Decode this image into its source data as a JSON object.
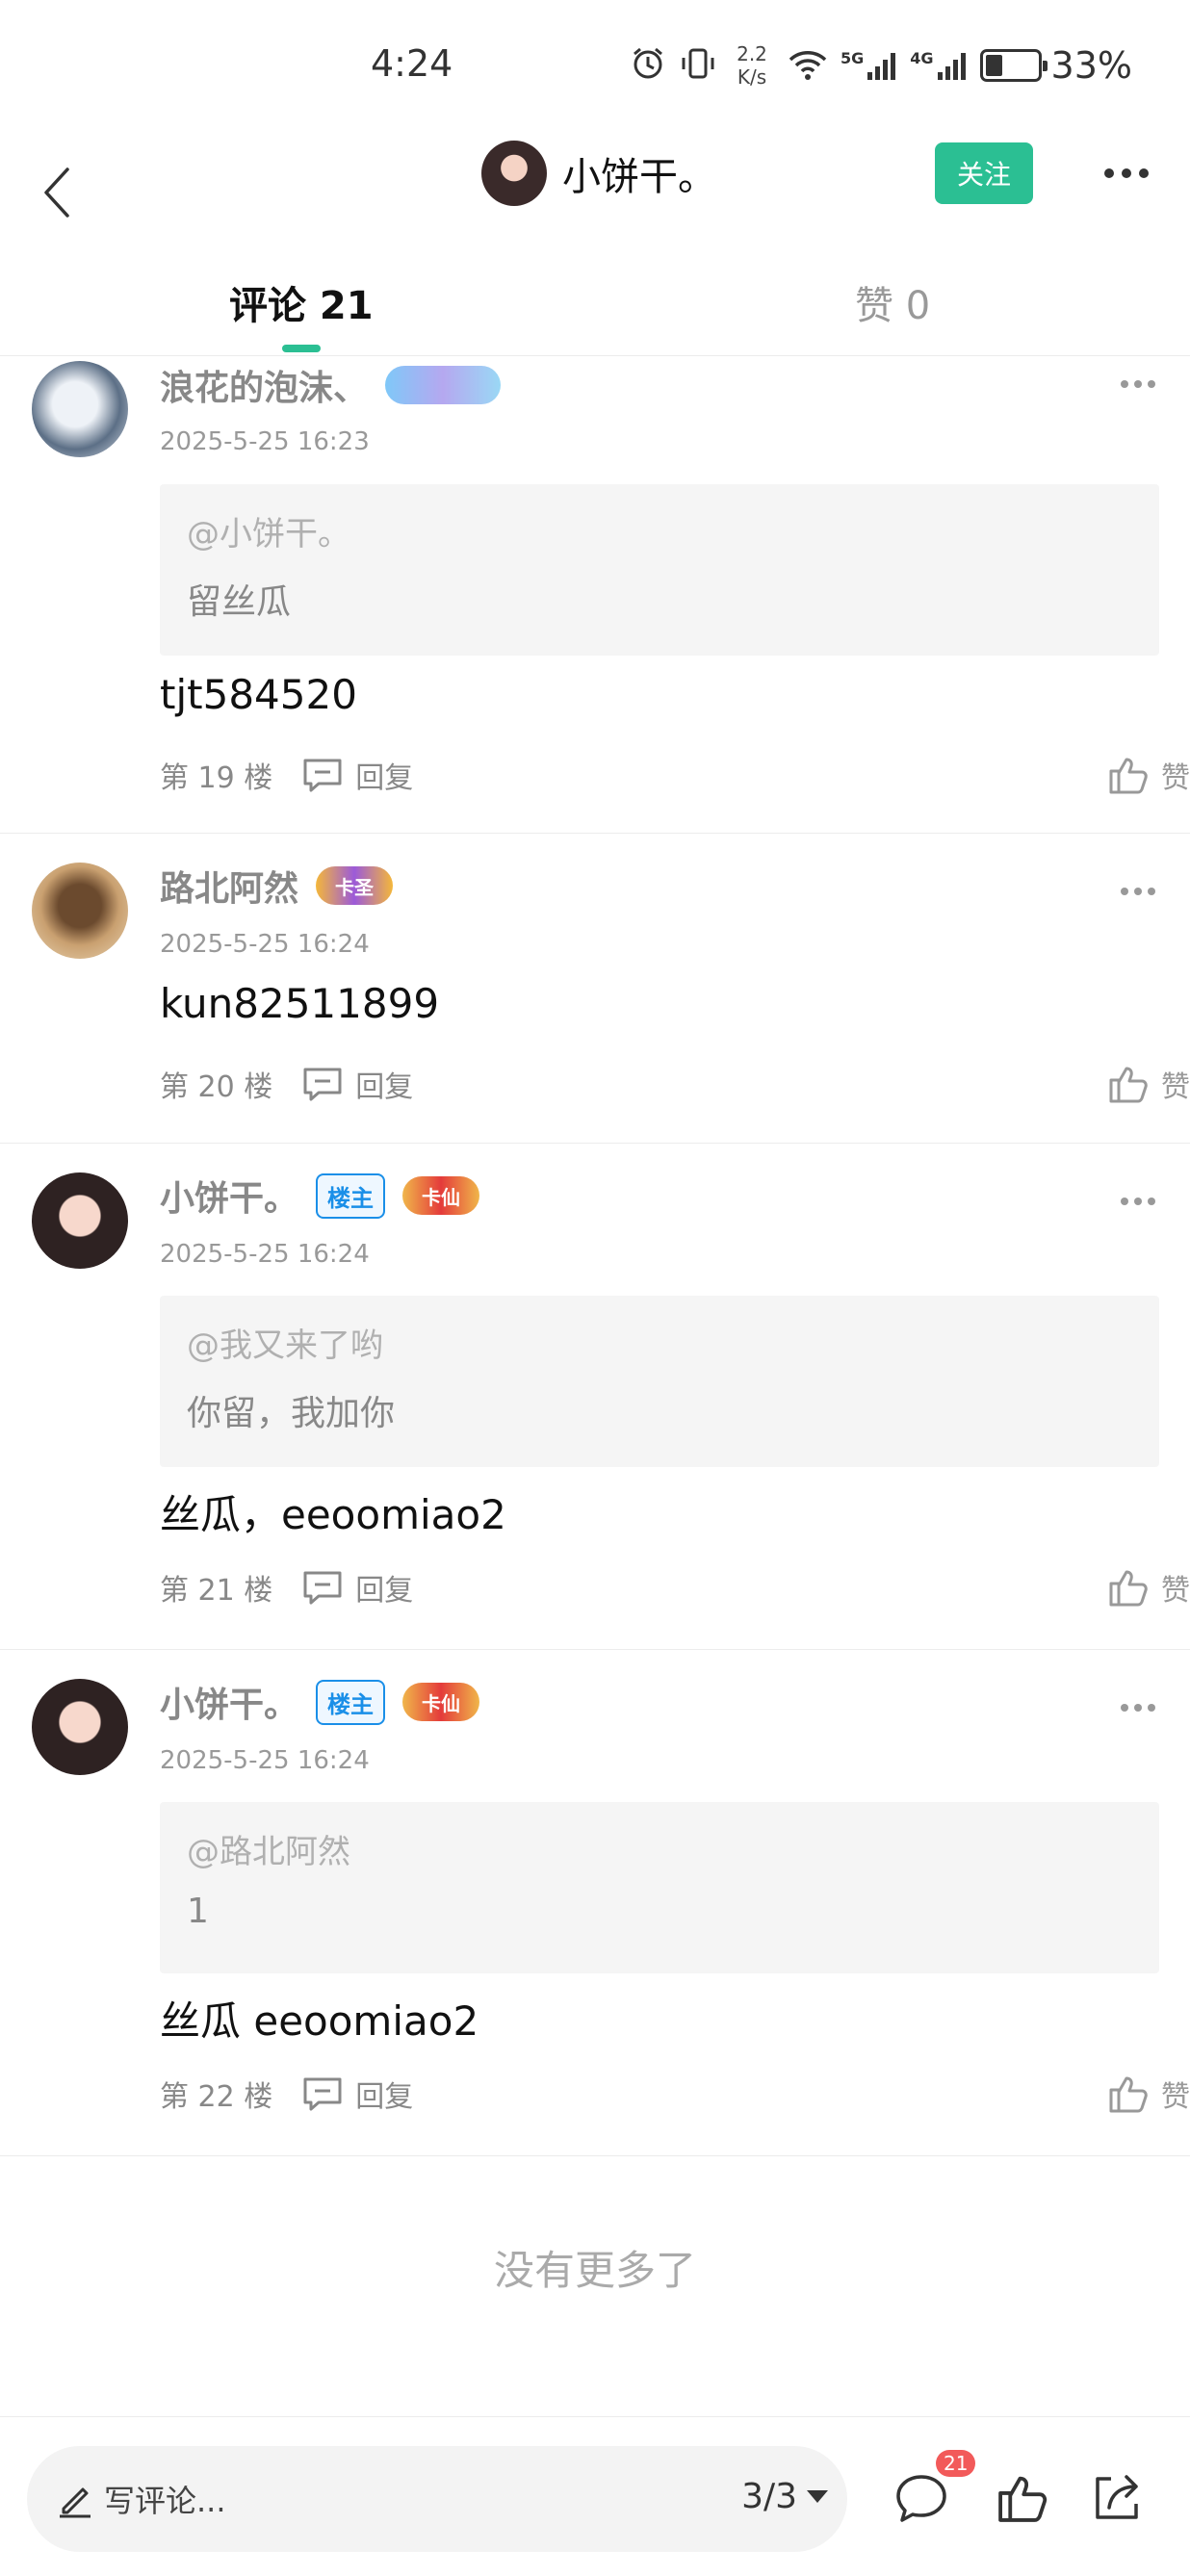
{
  "status_bar": {
    "time": "4:24",
    "speed_value": "2.2",
    "speed_unit": "K/s",
    "network_1": "5G",
    "network_2": "4G",
    "battery": "33%",
    "battery_level": 0.33
  },
  "header": {
    "username": "小饼干。",
    "follow_label": "关注"
  },
  "tabs": [
    {
      "label": "评论 21",
      "active": true
    },
    {
      "label": "赞 0",
      "active": false
    }
  ],
  "comments": [
    {
      "name": "浪花的泡沫、",
      "time": "2025-5-25 16:23",
      "is_owner": false,
      "medal": "",
      "quote_user": "@小饼干。",
      "quote_text": "留丝瓜",
      "body": "tjt584520",
      "floor": "第 19 楼",
      "reply_label": "回复",
      "like_label": "赞"
    },
    {
      "name": "路北阿然",
      "time": "2025-5-25 16:24",
      "is_owner": false,
      "medal": "卡圣",
      "body": "kun82511899",
      "floor": "第 20 楼",
      "reply_label": "回复",
      "like_label": "赞"
    },
    {
      "name": "小饼干。",
      "time": "2025-5-25 16:24",
      "is_owner": true,
      "owner_label": "楼主",
      "medal": "卡仙",
      "quote_user": "@我又来了哟",
      "quote_text": "你留，我加你",
      "body": "丝瓜，eeoomiao2",
      "floor": "第 21 楼",
      "reply_label": "回复",
      "like_label": "赞"
    },
    {
      "name": "小饼干。",
      "time": "2025-5-25 16:24",
      "is_owner": true,
      "owner_label": "楼主",
      "medal": "卡仙",
      "quote_user": "@路北阿然",
      "quote_text": "1",
      "body": "丝瓜 eeoomiao2",
      "floor": "第 22 楼",
      "reply_label": "回复",
      "like_label": "赞"
    }
  ],
  "end_text": "没有更多了",
  "bottom_bar": {
    "write_placeholder": "写评论...",
    "page_indicator": "3/3",
    "comment_count": "21"
  },
  "colors": {
    "accent": "#2bbf93",
    "owner_badge": "#1a8fe8",
    "count_badge": "#f25a5a"
  }
}
